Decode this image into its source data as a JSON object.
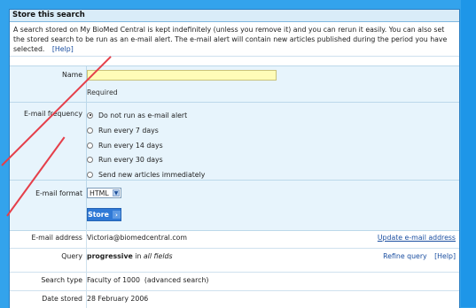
{
  "panel": {
    "title": "Store this search",
    "intro": "A search stored on My BioMed Central is kept indefinitely (unless you remove it) and you can rerun it easily. You can also set the stored search to be run as an e-mail alert. The e-mail alert will contain new articles published during the period you have selected.",
    "help_link": "[Help]"
  },
  "form": {
    "name_label": "Name",
    "name_value": "",
    "required_text": "Required",
    "email_frequency_label": "E-mail frequency",
    "options": [
      {
        "label": "Do not run as e-mail alert",
        "checked": true
      },
      {
        "label": "Run every 7 days",
        "checked": false
      },
      {
        "label": "Run every 14 days",
        "checked": false
      },
      {
        "label": "Run every 30 days",
        "checked": false
      },
      {
        "label": "Send new articles immediately",
        "checked": false
      }
    ],
    "email_format_label": "E-mail format",
    "email_format_value": "HTML",
    "store_button": "Store"
  },
  "details": {
    "email_address_label": "E-mail address",
    "email_address_value": "Victoria@biomedcentral.com",
    "update_email_link": "Update e-mail address",
    "query_label": "Query",
    "query_term": "progressive",
    "query_in": " in ",
    "query_fields": "all fields",
    "refine_query_link": "Refine query",
    "help_link": "[Help]",
    "search_type_label": "Search type",
    "search_type_value": "Faculty of 1000  (advanced search)",
    "date_stored_label": "Date stored",
    "date_stored_value": "28 February 2006"
  },
  "colors": {
    "page_bg": "#33a3ec",
    "input_highlight": "#fffcb8",
    "button": "#2f79d6",
    "annotation_line": "#e53f4a"
  }
}
